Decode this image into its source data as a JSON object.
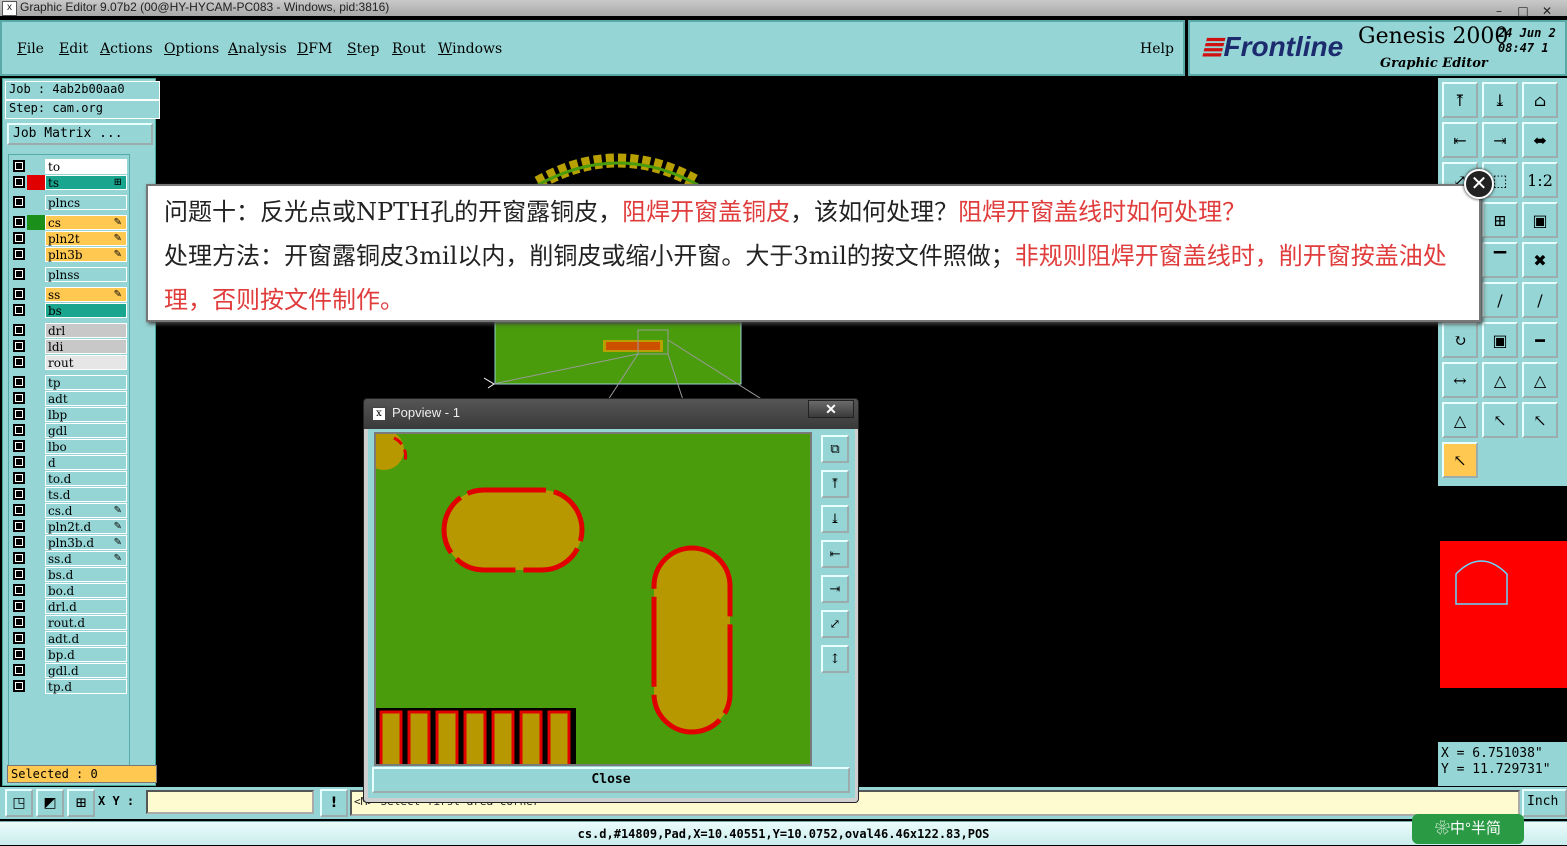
{
  "window": {
    "title": "Graphic Editor 9.07b2 (00@HY-HYCAM-PC083 - Windows, pid:3816)",
    "controls": [
      "–",
      "□",
      "✕"
    ]
  },
  "menu": {
    "items": [
      {
        "underline": "F",
        "rest": "ile"
      },
      {
        "underline": "E",
        "rest": "dit"
      },
      {
        "underline": "A",
        "rest": "ctions"
      },
      {
        "underline": "O",
        "rest": "ptions"
      },
      {
        "underline": "A",
        "rest": "nalysis"
      },
      {
        "underline": "D",
        "rest": "FM"
      },
      {
        "underline": "S",
        "rest": "tep"
      },
      {
        "underline": "R",
        "rest": "out"
      },
      {
        "underline": "W",
        "rest": "indows"
      }
    ],
    "help": "Help"
  },
  "brand": {
    "logo_mark": "≣",
    "logo_text": "Frontline",
    "product": "Genesis 2000",
    "subtitle": "Graphic Editor",
    "date": "24 Jun 2",
    "time": "08:47 1"
  },
  "job_panel": {
    "job": "Job : 4ab2b00aa0",
    "step": "Step: cam.org",
    "job_matrix": "Job Matrix ..."
  },
  "layers": [
    {
      "name": "to",
      "swatch": "#96d5d5",
      "fill": "#ffffff",
      "edit": false
    },
    {
      "name": "ts",
      "swatch": "#e00000",
      "fill": "#1aa58e",
      "edit": false,
      "icon": "⊞"
    },
    {
      "name": "plncs",
      "swatch": "#96d5d5",
      "fill": "#96d5d5",
      "edit": false
    },
    {
      "name": "cs",
      "swatch": "#1a8f1a",
      "fill": "#ffc851",
      "edit": true
    },
    {
      "name": "pln2t",
      "swatch": "#96d5d5",
      "fill": "#ffc851",
      "edit": true
    },
    {
      "name": "pln3b",
      "swatch": "#96d5d5",
      "fill": "#ffc851",
      "edit": true
    },
    {
      "name": "plnss",
      "swatch": "#96d5d5",
      "fill": "#96d5d5",
      "edit": false
    },
    {
      "name": "ss",
      "swatch": "#96d5d5",
      "fill": "#ffc851",
      "edit": true
    },
    {
      "name": "bs",
      "swatch": "#96d5d5",
      "fill": "#1aa58e",
      "edit": false
    },
    {
      "name": "drl",
      "swatch": "#96d5d5",
      "fill": "#c8c8c8",
      "edit": false
    },
    {
      "name": "ldi",
      "swatch": "#96d5d5",
      "fill": "#c8c8c8",
      "edit": false
    },
    {
      "name": "rout",
      "swatch": "#96d5d5",
      "fill": "#e6e6e6",
      "edit": false
    },
    {
      "name": "tp",
      "swatch": "#96d5d5",
      "fill": "#96d5d5",
      "edit": false
    },
    {
      "name": "adt",
      "swatch": "#96d5d5",
      "fill": "#96d5d5",
      "edit": false
    },
    {
      "name": "lbp",
      "swatch": "#96d5d5",
      "fill": "#96d5d5",
      "edit": false
    },
    {
      "name": "gdl",
      "swatch": "#96d5d5",
      "fill": "#96d5d5",
      "edit": false
    },
    {
      "name": "lbo",
      "swatch": "#96d5d5",
      "fill": "#96d5d5",
      "edit": false
    },
    {
      "name": "d",
      "swatch": "#96d5d5",
      "fill": "#96d5d5",
      "edit": false
    },
    {
      "name": "to.d",
      "swatch": "#96d5d5",
      "fill": "#96d5d5",
      "edit": false
    },
    {
      "name": "ts.d",
      "swatch": "#96d5d5",
      "fill": "#96d5d5",
      "edit": false
    },
    {
      "name": "cs.d",
      "swatch": "#96d5d5",
      "fill": "#96d5d5",
      "edit": true
    },
    {
      "name": "pln2t.d",
      "swatch": "#96d5d5",
      "fill": "#96d5d5",
      "edit": true
    },
    {
      "name": "pln3b.d",
      "swatch": "#96d5d5",
      "fill": "#96d5d5",
      "edit": true
    },
    {
      "name": "ss.d",
      "swatch": "#96d5d5",
      "fill": "#96d5d5",
      "edit": true
    },
    {
      "name": "bs.d",
      "swatch": "#96d5d5",
      "fill": "#96d5d5",
      "edit": false
    },
    {
      "name": "bo.d",
      "swatch": "#96d5d5",
      "fill": "#96d5d5",
      "edit": false
    },
    {
      "name": "drl.d",
      "swatch": "#96d5d5",
      "fill": "#96d5d5",
      "edit": false
    },
    {
      "name": "rout.d",
      "swatch": "#96d5d5",
      "fill": "#96d5d5",
      "edit": false
    },
    {
      "name": "adt.d",
      "swatch": "#96d5d5",
      "fill": "#96d5d5",
      "edit": false
    },
    {
      "name": "bp.d",
      "swatch": "#96d5d5",
      "fill": "#96d5d5",
      "edit": false
    },
    {
      "name": "gdl.d",
      "swatch": "#96d5d5",
      "fill": "#96d5d5",
      "edit": false
    },
    {
      "name": "tp.d",
      "swatch": "#96d5d5",
      "fill": "#96d5d5",
      "edit": false
    }
  ],
  "selected": "Selected : 0",
  "right_tools": [
    {
      "name": "tool-home-up",
      "glyph": "⤒"
    },
    {
      "name": "tool-home-down",
      "glyph": "⤓"
    },
    {
      "name": "tool-home",
      "glyph": "⌂"
    },
    {
      "name": "tool-pan-left",
      "glyph": "⇤"
    },
    {
      "name": "tool-pan-right",
      "glyph": "⇥"
    },
    {
      "name": "tool-zoom-fit",
      "glyph": "⬌"
    },
    {
      "name": "tool-zoom-in",
      "glyph": "⤢"
    },
    {
      "name": "tool-zoom-center",
      "glyph": "⬚"
    },
    {
      "name": "tool-scale-1-2",
      "glyph": "1:2"
    },
    {
      "name": "tool-grid",
      "glyph": "▦"
    },
    {
      "name": "tool-snap",
      "glyph": "⊞"
    },
    {
      "name": "tool-layers",
      "glyph": "▣"
    },
    {
      "name": "tool-measure",
      "glyph": "◩"
    },
    {
      "name": "tool-ruler",
      "glyph": "▔"
    },
    {
      "name": "tool-cross",
      "glyph": "✖"
    },
    {
      "name": "tool-connect",
      "glyph": "☍"
    },
    {
      "name": "tool-line",
      "glyph": "∕"
    },
    {
      "name": "tool-line-2",
      "glyph": "∕"
    },
    {
      "name": "tool-arc",
      "glyph": "↻"
    },
    {
      "name": "tool-pad",
      "glyph": "▣"
    },
    {
      "name": "tool-hline",
      "glyph": "━"
    },
    {
      "name": "tool-dim",
      "glyph": "↔"
    },
    {
      "name": "tool-tri-1",
      "glyph": "△"
    },
    {
      "name": "tool-tri-2",
      "glyph": "△"
    },
    {
      "name": "tool-tri-3",
      "glyph": "△"
    },
    {
      "name": "tool-select",
      "glyph": "↖"
    },
    {
      "name": "tool-select-2",
      "glyph": "↖"
    },
    {
      "name": "tool-select-3",
      "glyph": "↖"
    }
  ],
  "coords": {
    "x": "X = 6.751038\"",
    "y": "Y = 11.729731\""
  },
  "bottom": {
    "buttons": [
      "◳",
      "◩",
      "⊞"
    ],
    "xy_label": "X Y :",
    "xy_value": "",
    "alert": "!",
    "message": "<M>  Select first area corner",
    "unit": "Inch",
    "status": "cs.d,#14809,Pad,X=10.40551,Y=10.0752,oval46.46x122.83,POS"
  },
  "ime": "❀中°半简",
  "callout": {
    "line1_a": "问题十：反光点或NPTH孔的开窗露铜皮，",
    "line1_b": "阻焊开窗盖铜皮",
    "line1_c": "，该如何处理？",
    "line1_d": "阻焊开窗盖线时如何处理？",
    "line2_a": "处理方法：开窗露铜皮3mil以内，削铜皮或缩小开窗。大于3mil的按文件照做；",
    "line2_b": "非规则阻焊开窗盖线时，削开窗按盖油处理，否则按文件制作。",
    "close": "✕"
  },
  "popview": {
    "title": "Popview - 1",
    "close_x": "✕",
    "close_button": "Close",
    "side_buttons": [
      "⧉",
      "⤒",
      "⤓",
      "⇤",
      "⇥",
      "⤢",
      "↕"
    ]
  }
}
